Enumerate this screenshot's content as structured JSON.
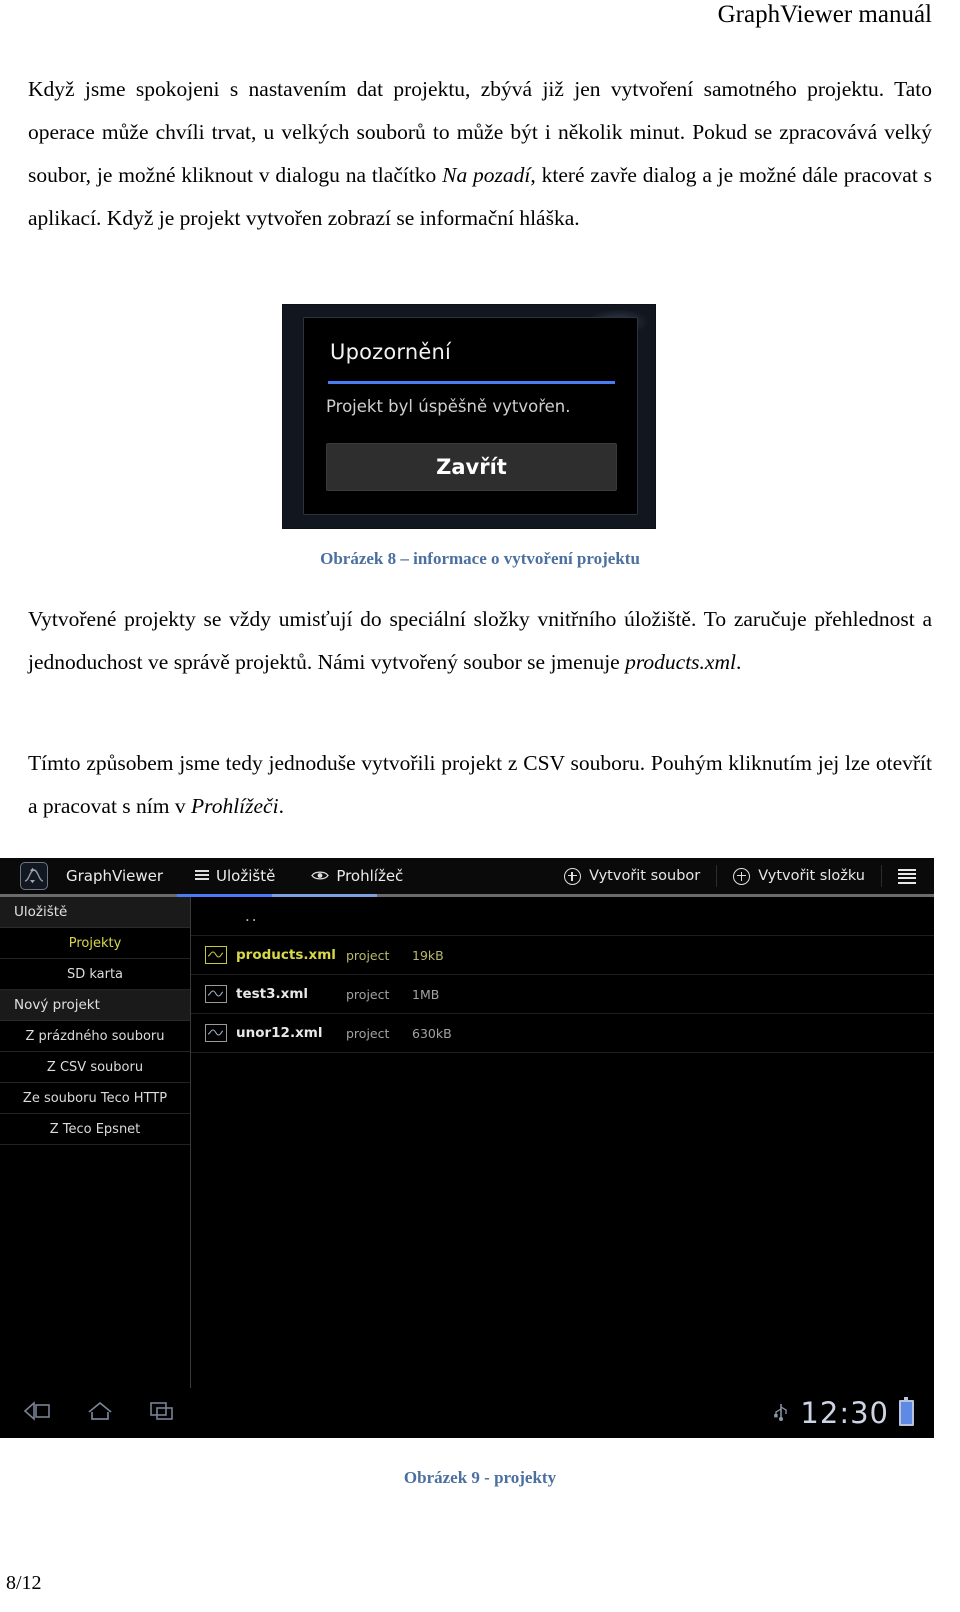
{
  "page": {
    "header": "GraphViewer manuál",
    "footer": "8/12"
  },
  "paragraphs": {
    "p1_a": "Když jsme spokojeni s nastavením dat projektu, zbývá již jen vytvoření samotného projektu. Tato operace může chvíli trvat, u velkých souborů to může být i několik minut. Pokud se zpracovává velký soubor, je možné kliknout v dialogu na tlačítko ",
    "p1_em": "Na pozadí",
    "p1_b": ", které zavře dialog a je možné dále pracovat s aplikací. Když je projekt vytvořen zobrazí se informační hláška.",
    "p2_a": "Vytvořené projekty se vždy umisťují do speciální složky vnitřního úložiště. To zaručuje přehlednost a jednoduchost ve správě projektů. Námi vytvořený soubor se jmenuje ",
    "p2_em": "products.xml",
    "p2_b": ".",
    "p3_a": "Tímto způsobem jsme tedy jednoduše vytvořili projekt z CSV souboru. Pouhým kliknutím jej lze otevřít a pracovat s ním v ",
    "p3_em": "Prohlížeči",
    "p3_b": "."
  },
  "captions": {
    "figure8": "Obrázek 8 – informace o vytvoření projektu",
    "figure9": "Obrázek 9 - projekty",
    "color": "#4b6f9e"
  },
  "dialog": {
    "title": "Upozornění",
    "message": "Projekt byl úspěšně vytvořen.",
    "button": "Zavřít",
    "accent": "#4a7df5",
    "background": "#000000"
  },
  "android": {
    "actionbar": {
      "app_name": "GraphViewer",
      "tabs": [
        {
          "label": "Uložiště",
          "icon": "list-icon",
          "active": true
        },
        {
          "label": "Prohlížeč",
          "icon": "eye-icon",
          "active": false
        }
      ],
      "actions": [
        {
          "label": "Vytvořit soubor",
          "icon": "plus-circle-icon"
        },
        {
          "label": "Vytvořit složku",
          "icon": "plus-circle-icon"
        }
      ],
      "overflow_icon": "hamburger-menu-icon",
      "accent": "#4a7df5"
    },
    "sidebar": {
      "sections": [
        {
          "header": "Uložiště",
          "items": [
            {
              "label": "Projekty",
              "selected": true
            },
            {
              "label": "SD karta",
              "selected": false
            }
          ]
        },
        {
          "header": "Nový projekt",
          "items": [
            {
              "label": "Z prázdného souboru",
              "selected": false
            },
            {
              "label": "Z CSV souboru",
              "selected": false
            },
            {
              "label": "Ze souboru Teco HTTP",
              "selected": false
            },
            {
              "label": "Z Teco Epsnet",
              "selected": false
            }
          ]
        }
      ],
      "selected_color": "#d8d84a"
    },
    "filelist": {
      "parent_dir": "..",
      "columns": [
        "name",
        "type",
        "size"
      ],
      "rows": [
        {
          "name": "products.xml",
          "type": "project",
          "size": "19kB",
          "highlight": true
        },
        {
          "name": "test3.xml",
          "type": "project",
          "size": "1MB",
          "highlight": false
        },
        {
          "name": "unor12.xml",
          "type": "project",
          "size": "630kB",
          "highlight": false
        }
      ]
    },
    "systembar": {
      "back_icon": "back-arrow-icon",
      "home_icon": "home-icon",
      "recents_icon": "recent-apps-icon",
      "usb_icon": "usb-icon",
      "clock": "12:30",
      "battery_icon": "battery-icon"
    }
  }
}
